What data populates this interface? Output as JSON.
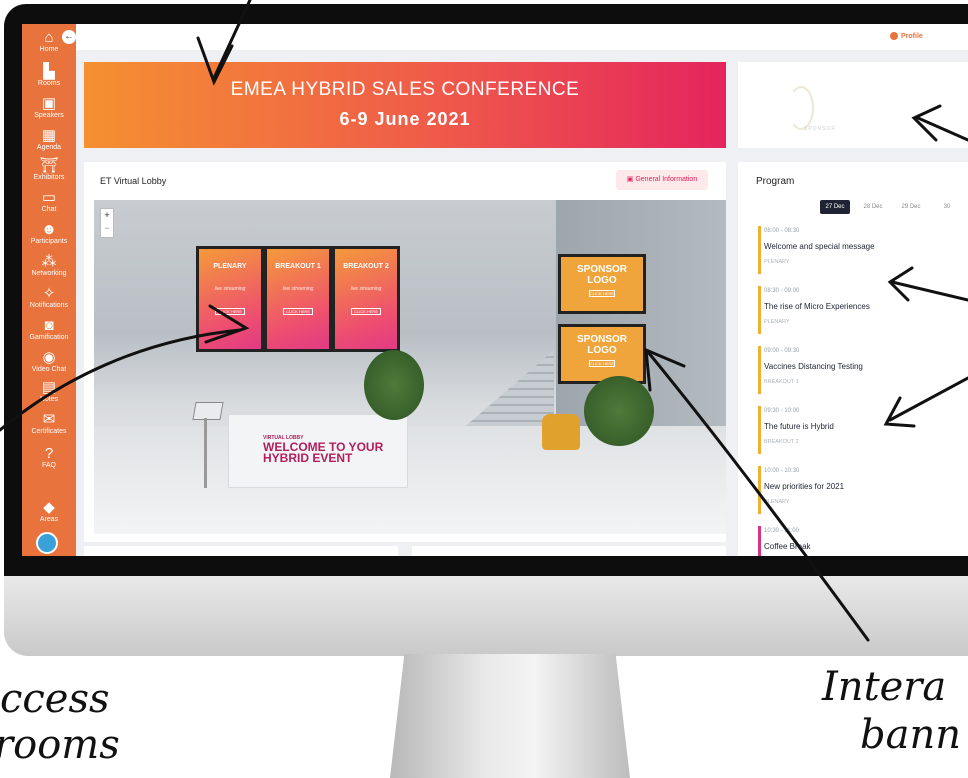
{
  "sidebar": {
    "items": [
      {
        "label": "Home",
        "icon": "home-icon",
        "glyph": "⌂"
      },
      {
        "label": "Rooms",
        "icon": "door-icon",
        "glyph": "▙"
      },
      {
        "label": "Speakers",
        "icon": "speaker-icon",
        "glyph": "▣"
      },
      {
        "label": "Agenda",
        "icon": "calendar-icon",
        "glyph": "▦"
      },
      {
        "label": "Exhibitors",
        "icon": "booth-icon",
        "glyph": "⛩"
      },
      {
        "label": "Chat",
        "icon": "chat-icon",
        "glyph": "▭"
      },
      {
        "label": "Participants",
        "icon": "people-icon",
        "glyph": "☻"
      },
      {
        "label": "Networking",
        "icon": "network-icon",
        "glyph": "⁂"
      },
      {
        "label": "Notifications",
        "icon": "bell-icon",
        "glyph": "✧"
      },
      {
        "label": "Gamification",
        "icon": "gamepad-icon",
        "glyph": "◙"
      },
      {
        "label": "Video Chat",
        "icon": "video-chat-icon",
        "glyph": "◉"
      },
      {
        "label": "Notes",
        "icon": "clipboard-icon",
        "glyph": "▤"
      },
      {
        "label": "Certificates",
        "icon": "certificate-icon",
        "glyph": "✉"
      },
      {
        "label": "FAQ",
        "icon": "question-icon",
        "glyph": "?"
      },
      {
        "label": "Areas",
        "icon": "layers-icon",
        "glyph": "◆"
      }
    ]
  },
  "topbar": {
    "profile_label": "Profile"
  },
  "banner": {
    "title": "EMEA HYBRID SALES CONFERENCE",
    "dates": "6-9 June 2021"
  },
  "sponsor_card": {
    "text": "SPONSOR"
  },
  "lobby": {
    "title": "ET Virtual Lobby",
    "general_info_label": "General Information",
    "zoom_in": "+",
    "zoom_out": "−",
    "posters": [
      {
        "heading": "PLENARY",
        "sub": "live streaming",
        "button": "CLICK HERE"
      },
      {
        "heading": "BREAKOUT 1",
        "sub": "live streaming",
        "button": "CLICK HERE"
      },
      {
        "heading": "BREAKOUT 2",
        "sub": "live streaming",
        "button": "CLICK HERE"
      }
    ],
    "sponsor_posters": [
      {
        "heading": "SPONSOR LOGO",
        "button": "CLICK HERE"
      },
      {
        "heading": "SPONSOR LOGO",
        "button": "CLICK HERE"
      }
    ],
    "desk_small": "VIRTUAL LOBBY",
    "desk_big": "WELCOME TO YOUR HYBRID EVENT"
  },
  "program": {
    "title": "Program",
    "dates": [
      {
        "label": "27 Dec",
        "active": true
      },
      {
        "label": "28 Dec",
        "active": false
      },
      {
        "label": "29 Dec",
        "active": false
      },
      {
        "label": "30",
        "active": false
      }
    ],
    "sessions": [
      {
        "time": "08:00 - 08:30",
        "title": "Welcome and special message",
        "room": "PLENARY",
        "color": "#f0b030"
      },
      {
        "time": "08:30 - 09:00",
        "title": "The rise of Micro Experiences",
        "room": "PLENARY",
        "color": "#f0b030"
      },
      {
        "time": "09:00 - 09:30",
        "title": "Vaccines Distancing Testing",
        "room": "BREAKOUT 1",
        "color": "#f0b030"
      },
      {
        "time": "09:30 - 10:00",
        "title": "The future is Hybrid",
        "room": "BREAKOUT 2",
        "color": "#f0b030"
      },
      {
        "time": "10:00 - 10:30",
        "title": "New priorities for 2021",
        "room": "PLENARY",
        "color": "#f0b030"
      },
      {
        "time": "10:30 - 11:00",
        "title": "Coffee Break",
        "room": "",
        "color": "#d63384"
      }
    ]
  },
  "annotations": {
    "left_caption": "ccess\nrooms",
    "right_caption": "Intera\nbann"
  }
}
